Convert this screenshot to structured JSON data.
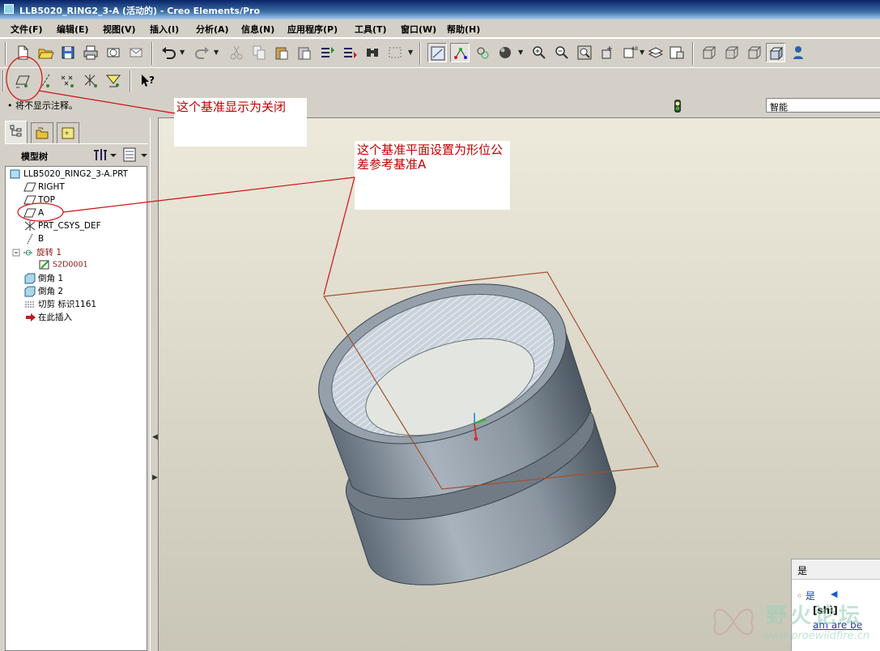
{
  "window": {
    "title": "LLB5020_RING2_3-A (活动的) - Creo Elements/Pro"
  },
  "menu": {
    "items": [
      "文件(F)",
      "编辑(E)",
      "视图(V)",
      "插入(I)",
      "分析(A)",
      "信息(N)",
      "应用程序(P)",
      "工具(T)",
      "窗口(W)",
      "帮助(H)"
    ]
  },
  "toolbar1": {
    "icons": [
      "new-file-icon",
      "open-folder-icon",
      "save-icon",
      "print-icon",
      "email-icon",
      "email-link-icon",
      "undo-icon",
      "redo-icon",
      "cut-icon",
      "copy-icon",
      "paste-icon",
      "paste-special-icon",
      "regenerate-icon",
      "regen-manager-icon",
      "find-icon",
      "select-box-icon",
      "spin-center-icon",
      "orient-icon",
      "datum-display-icon",
      "shading-icon",
      "zoom-in-icon",
      "zoom-out-icon",
      "refit-icon",
      "reorient-icon",
      "saved-views-icon",
      "layers-icon",
      "view-manager-icon",
      "wireframe-icon",
      "hidden-line-icon",
      "no-hidden-icon",
      "shaded-icon",
      "model-tree-icon"
    ]
  },
  "toolbar2": {
    "icons": [
      "datum-plane-display-icon",
      "datum-axis-display-icon",
      "datum-point-display-icon",
      "csys-display-icon",
      "annotation-display-icon",
      "context-help-icon"
    ]
  },
  "message": "• 将不显示注释。",
  "filter": {
    "value": "智能"
  },
  "panel": {
    "tabs": [
      "model-tree-tab-icon",
      "folder-browser-tab-icon",
      "favorites-tab-icon"
    ],
    "tree_title": "模型树",
    "tree": [
      {
        "label": "LLB5020_RING2_3-A.PRT",
        "icon": "part-icon",
        "level": 0,
        "red": false
      },
      {
        "label": "RIGHT",
        "icon": "datum-plane-icon",
        "level": 1,
        "red": false
      },
      {
        "label": "TOP",
        "icon": "datum-plane-icon",
        "level": 1,
        "red": false
      },
      {
        "label": "A",
        "icon": "datum-plane-icon",
        "level": 1,
        "red": false
      },
      {
        "label": "PRT_CSYS_DEF",
        "icon": "csys-icon",
        "level": 1,
        "red": false
      },
      {
        "label": "B",
        "icon": "datum-axis-icon",
        "level": 1,
        "red": false
      },
      {
        "label": "旋转 1",
        "icon": "revolve-icon",
        "level": 1,
        "red": true
      },
      {
        "label": "S2D0001",
        "icon": "sketch-icon",
        "level": 2,
        "red": true
      },
      {
        "label": "倒角 1",
        "icon": "chamfer-icon",
        "level": 1,
        "red": false
      },
      {
        "label": "倒角 2",
        "icon": "chamfer-icon",
        "level": 1,
        "red": false
      },
      {
        "label": "切剪 标识1161",
        "icon": "cosmetic-thread-icon",
        "level": 1,
        "red": false
      },
      {
        "label": "在此插入",
        "icon": "insert-here-icon",
        "level": 1,
        "red": false
      }
    ]
  },
  "annotations": {
    "note1": "这个基准显示为关闭",
    "note2": "这个基准平面设置为形位公差参考基准A",
    "color": "#c00000"
  },
  "popup": {
    "title": "是",
    "item": "◦ 是",
    "phonetic": "[shì]",
    "words": "am are be"
  },
  "watermark": {
    "text": "野火论坛",
    "url": "www.proewildfire.cn"
  },
  "colors": {
    "titlebar": "#0a246a",
    "chrome": "#d4d0c8",
    "model": "#8e98a3",
    "datum_plane": "#a0522d"
  }
}
